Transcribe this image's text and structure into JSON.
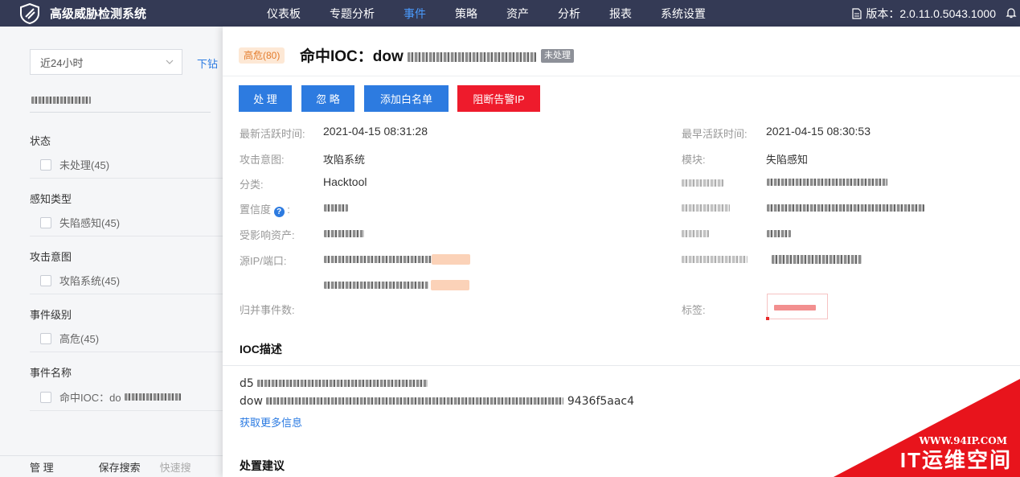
{
  "header": {
    "app_title": "高级威胁检测系统",
    "nav": [
      {
        "label": "仪表板"
      },
      {
        "label": "专题分析"
      },
      {
        "label": "事件",
        "active": true
      },
      {
        "label": "策略"
      },
      {
        "label": "资产"
      },
      {
        "label": "分析"
      },
      {
        "label": "报表"
      },
      {
        "label": "系统设置"
      }
    ],
    "version_label": "版本：2.0.11.0.5043.1000",
    "accent_color": "#4a9bff",
    "bar_color": "#343a55"
  },
  "filters": {
    "time_range": "近24小时",
    "drill_link": "下钻",
    "groups": [
      {
        "title": "状态",
        "option": "未处理(45)"
      },
      {
        "title": "感知类型",
        "option": "失陷感知(45)"
      },
      {
        "title": "攻击意图",
        "option": "攻陷系统(45)"
      },
      {
        "title": "事件级别",
        "option": "高危(45)"
      },
      {
        "title": "事件名称",
        "option": "命中IOC：do"
      }
    ],
    "bottom": {
      "manage": "管 理",
      "save_search": "保存搜索",
      "quick_search": "快速搜"
    }
  },
  "event": {
    "severity_badge": "高危(80)",
    "title": "命中IOC：dow",
    "status": "未处理",
    "actions": {
      "handle": "处 理",
      "ignore": "忽 略",
      "whitelist": "添加白名单",
      "block_ip": "阻断告警IP"
    },
    "fields": {
      "latest_active_label": "最新活跃时间:",
      "latest_active": "2021-04-15 08:31:28",
      "earliest_active_label": "最早活跃时间:",
      "earliest_active": "2021-04-15 08:30:53",
      "intent_label": "攻击意图:",
      "intent": "攻陷系统",
      "module_label": "模块:",
      "module": "失陷感知",
      "category_label": "分类:",
      "category": "Hacktool",
      "confidence_label": "置信度",
      "affected_label": "受影响资产:",
      "src_label": "源IP/端口:",
      "merged_label": "归并事件数:",
      "tags_label": "标签:"
    },
    "ioc_section_title": "IOC描述",
    "ioc_line1_prefix": "d5",
    "ioc_line2_prefix": "dow",
    "ioc_line2_suffix": "9436f5aac4",
    "more_info": "获取更多信息",
    "advice_title": "处置建议"
  },
  "watermark": {
    "url": "WWW.94IP.COM",
    "text": "IT运维空间"
  },
  "colors": {
    "primary": "#2d7be0",
    "danger": "#ee1b2c",
    "watermark": "#e8141c"
  }
}
